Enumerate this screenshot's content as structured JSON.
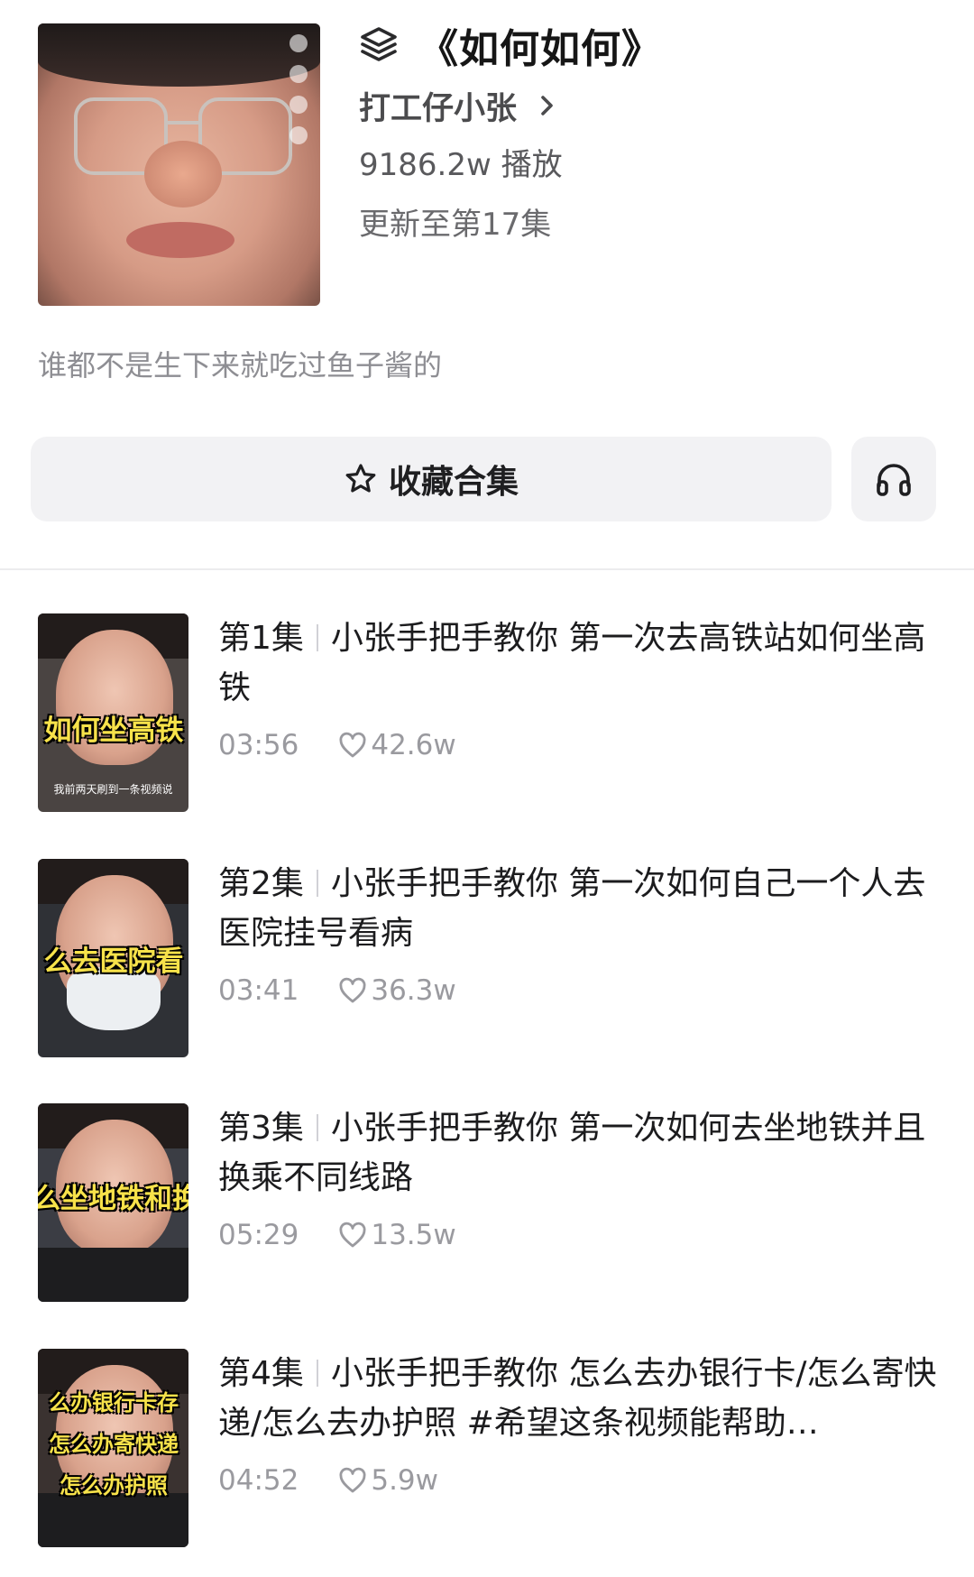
{
  "collection": {
    "title": "《如何如何》",
    "author": "打工仔小张",
    "plays": "9186.2w 播放",
    "update_status": "更新至第17集",
    "description": "谁都不是生下来就吃过鱼子酱的"
  },
  "actions": {
    "favorite_label": "收藏合集",
    "listen_icon": "headphones-icon"
  },
  "episodes": [
    {
      "number": "第1集",
      "title": "小张手把手教你 第一次去高铁站如何坐高铁",
      "duration": "03:56",
      "likes": "42.6w",
      "thumb_caption": "如何坐高铁",
      "thumb_sub": "我前两天刷到一条视频说"
    },
    {
      "number": "第2集",
      "title": "小张手把手教你 第一次如何自己一个人去医院挂号看病",
      "duration": "03:41",
      "likes": "36.3w",
      "thumb_caption": "么去医院看"
    },
    {
      "number": "第3集",
      "title": "小张手把手教你 第一次如何去坐地铁并且换乘不同线路",
      "duration": "05:29",
      "likes": "13.5w",
      "thumb_caption": "么坐地铁和换"
    },
    {
      "number": "第4集",
      "title": "小张手把手教你 怎么去办银行卡/怎么寄快递/怎么去办护照 #希望这条视频能帮助…",
      "duration": "04:52",
      "likes": "5.9w",
      "thumb_caption_lines": [
        "么办银行卡存",
        "怎么办寄快递",
        "怎么办护照"
      ]
    }
  ]
}
